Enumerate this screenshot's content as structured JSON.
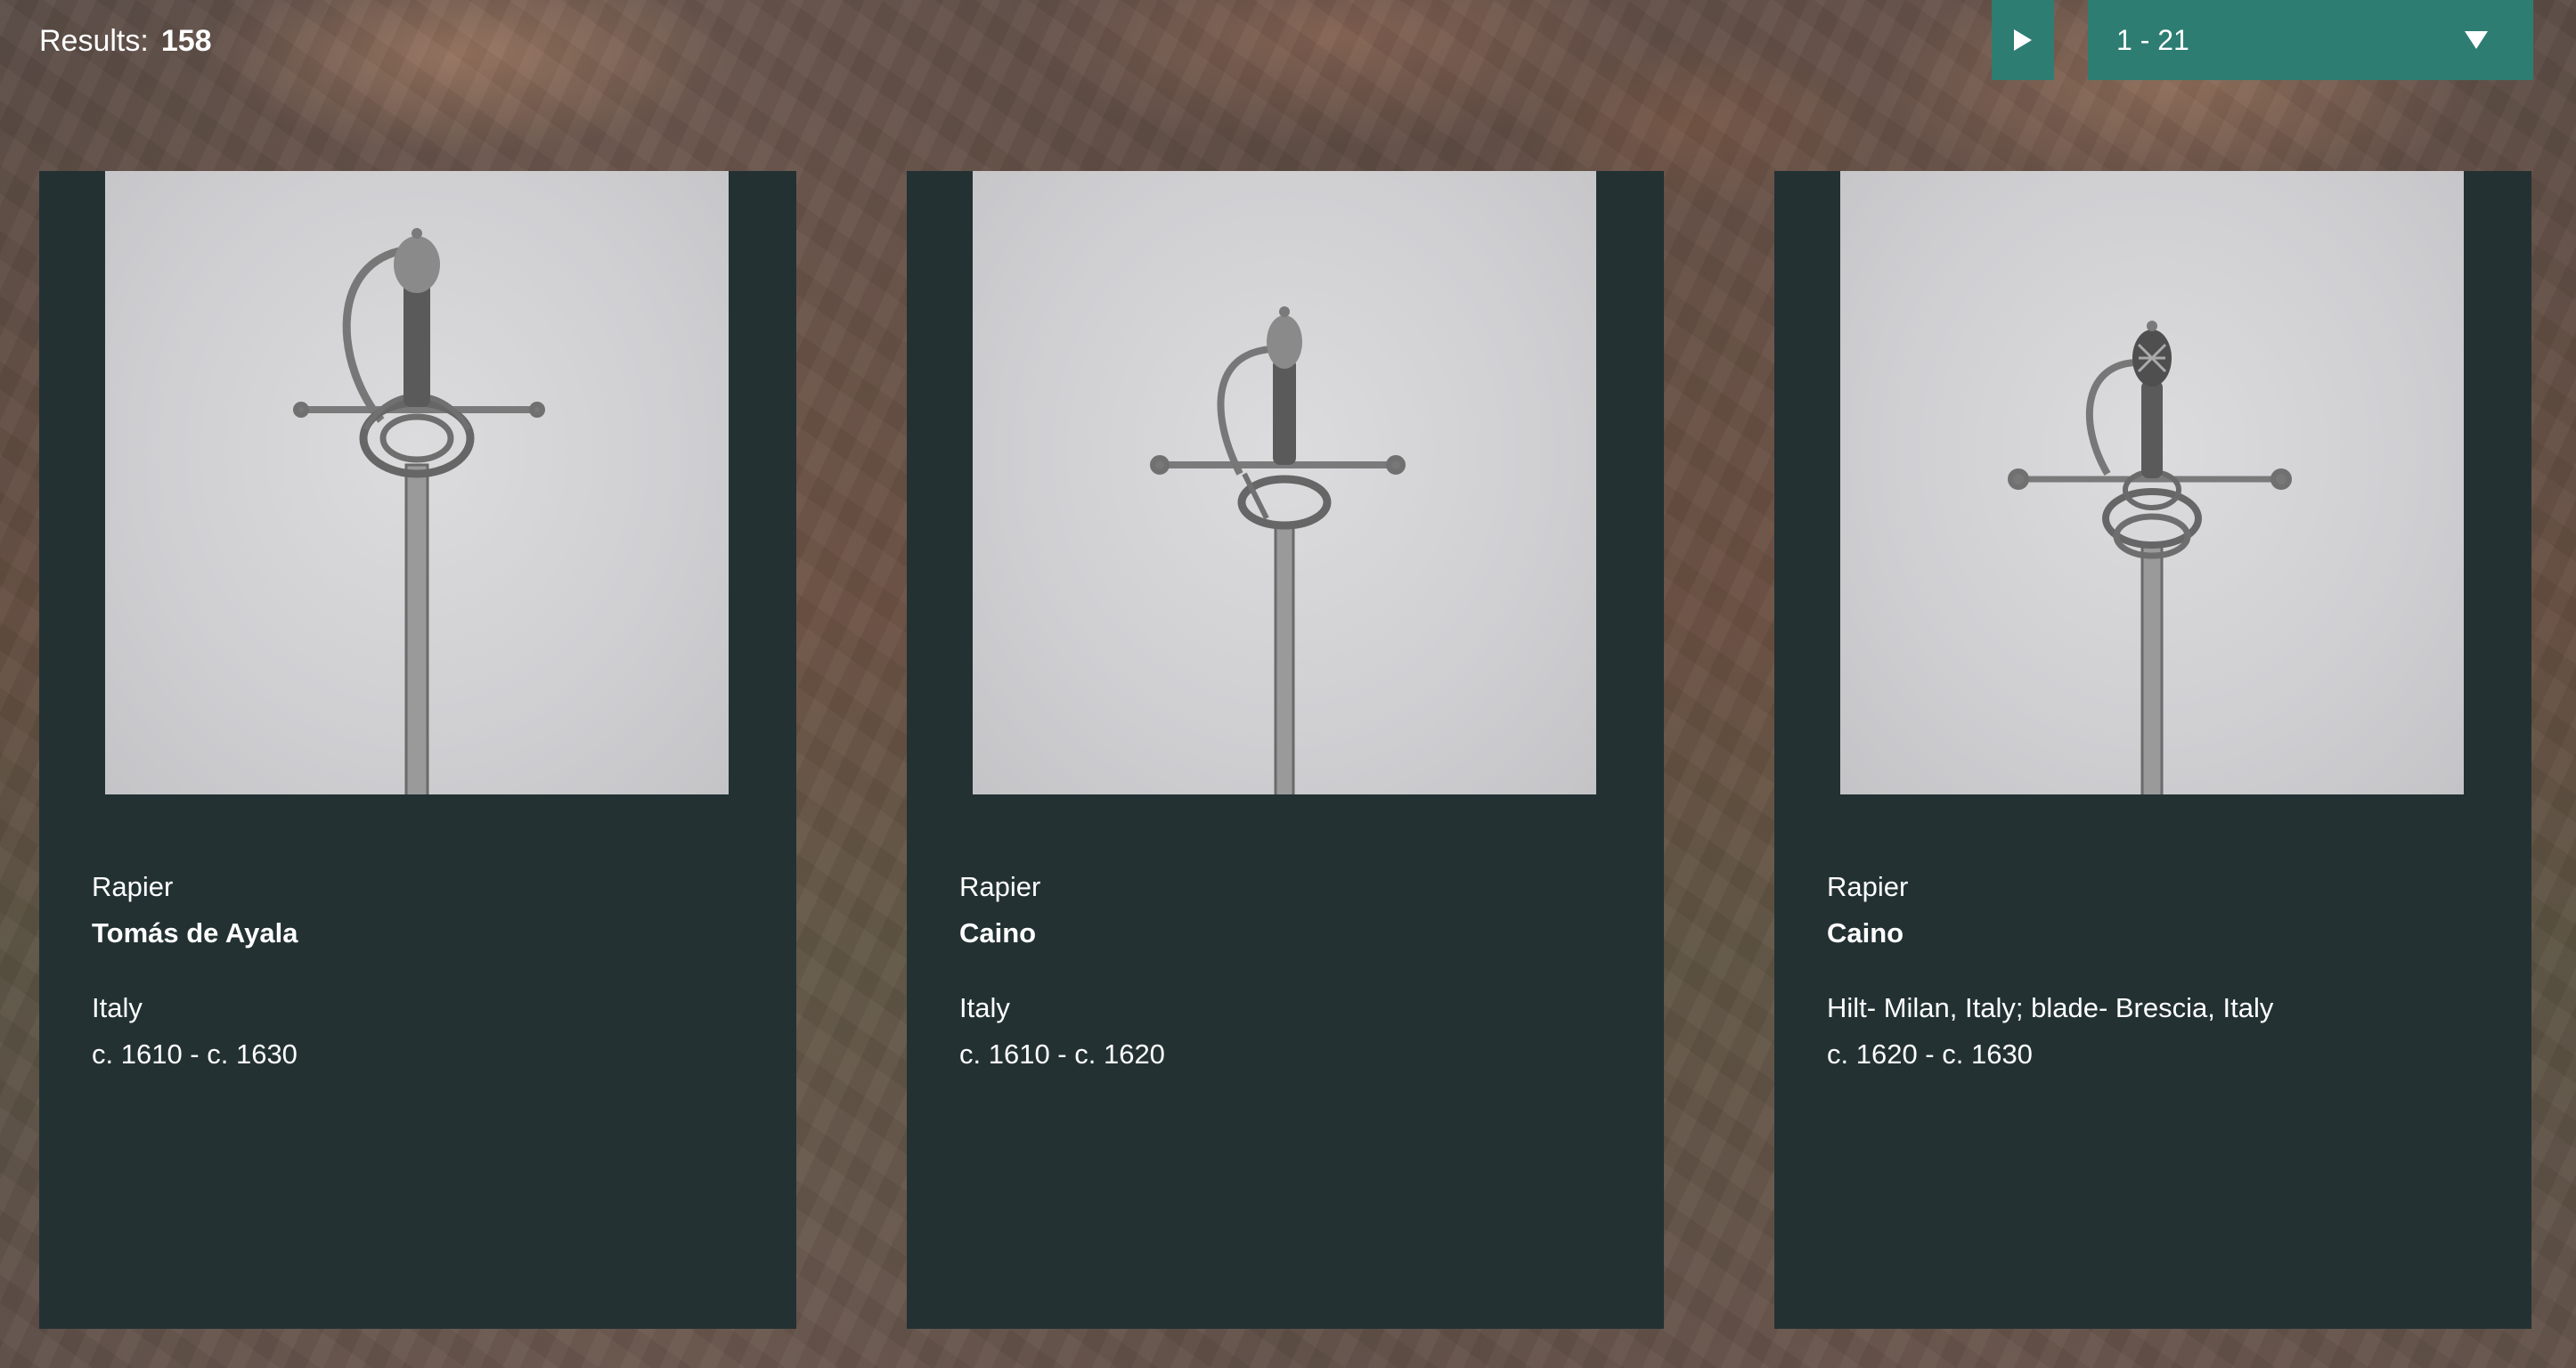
{
  "header": {
    "results_label": "Results:",
    "results_count": "158",
    "play_icon": "play-icon",
    "page_range": "1 - 21",
    "dropdown_icon": "caret-down-icon",
    "accent_color": "#2e7d73"
  },
  "cards": [
    {
      "title": "Rapier",
      "maker": "Tomás de Ayala",
      "place": "Italy",
      "date": "c. 1610 - c. 1630",
      "image_icon": "rapier-image"
    },
    {
      "title": "Rapier",
      "maker": "Caino",
      "place": "Italy",
      "date": "c. 1610 - c. 1620",
      "image_icon": "rapier-image"
    },
    {
      "title": "Rapier",
      "maker": "Caino",
      "place": "Hilt- Milan, Italy; blade- Brescia, Italy",
      "date": "c. 1620 - c. 1630",
      "image_icon": "rapier-image"
    }
  ],
  "colors": {
    "card_background": "#233133",
    "text": "#ffffff"
  }
}
